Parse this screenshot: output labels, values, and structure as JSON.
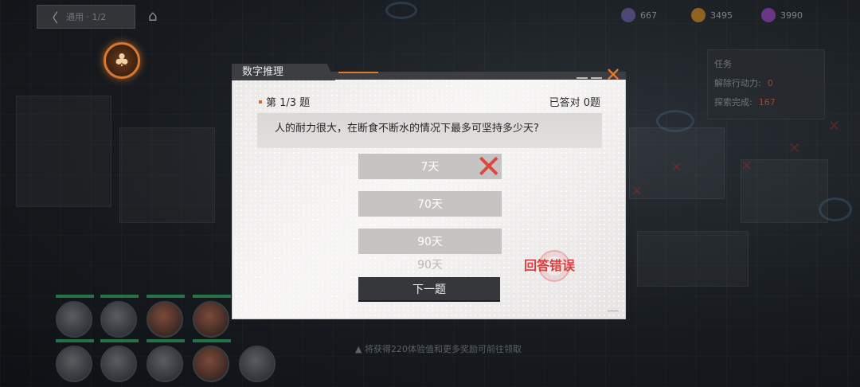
{
  "topbar": {
    "back_label": "〈",
    "location_label": "通用 · 1/2",
    "home_icon": "home-icon",
    "resources": [
      {
        "icon": "stamina-icon",
        "value": "667",
        "color": "#6b5fa0"
      },
      {
        "icon": "coin-icon",
        "value": "3495",
        "color": "#c98b2a"
      },
      {
        "icon": "gem-icon",
        "value": "3990",
        "color": "#a24cc9"
      }
    ]
  },
  "side_panel": {
    "title": "任务",
    "row1_label": "解除行动力:",
    "row1_value": "0",
    "row2_label": "探索完成:",
    "row2_value": "167"
  },
  "background_notice": "将获得220体验值和更多奖励可前往领取",
  "quiz": {
    "window_title": "数字推理",
    "close_icon": "close-icon",
    "question_number": "第 1/3 题",
    "answered_count": "已答对 0题",
    "question_text": "人的耐力很大，在断食不断水的情况下最多可坚持多少天?",
    "options": [
      "7天",
      "70天",
      "90天"
    ],
    "wrong_option_index": 0,
    "selected_answer_echo": "90天",
    "result_text": "回答错误",
    "next_button_label": "下一题",
    "colors": {
      "accent": "#e07a2d",
      "wrong": "#e23c3c",
      "option_bg": "#c6c4c3",
      "button_bg": "#35373b"
    }
  }
}
